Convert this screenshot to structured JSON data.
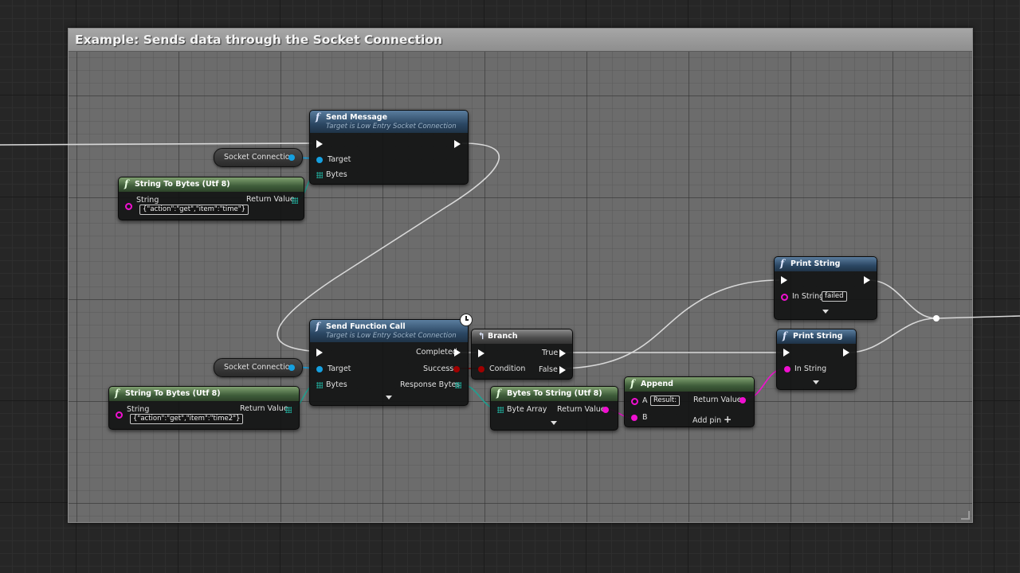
{
  "comment": {
    "title": "Example: Sends data through the Socket Connection"
  },
  "icons": {
    "function": "f-function-icon",
    "branch": "branch-icon",
    "latent": "clock-icon",
    "add": "plus-icon"
  },
  "colors": {
    "exec_wire": "#dddddd",
    "object_pin": "#15a0e0",
    "string_pin": "#f010d0",
    "bool_pin": "#a00000",
    "byte_array_pin": "#20a090"
  },
  "getter1": {
    "label": "Socket Connection"
  },
  "getter2": {
    "label": "Socket Connection"
  },
  "send_message": {
    "title": "Send Message",
    "subtitle": "Target is Low Entry Socket Connection",
    "target": "Target",
    "bytes": "Bytes"
  },
  "string_to_bytes1": {
    "title": "String To Bytes (Utf 8)",
    "string_label": "String",
    "string_value": "{\"action\":\"get\",\"item\":\"time\"}",
    "return_value": "Return Value"
  },
  "send_function_call": {
    "title": "Send Function Call",
    "subtitle": "Target is Low Entry Socket Connection",
    "completed": "Completed",
    "target": "Target",
    "success": "Success",
    "bytes": "Bytes",
    "response_bytes": "Response Bytes"
  },
  "string_to_bytes2": {
    "title": "String To Bytes (Utf 8)",
    "string_label": "String",
    "string_value": "{\"action\":\"get\",\"item\":\"time2\"}",
    "return_value": "Return Value"
  },
  "branch": {
    "title": "Branch",
    "true": "True",
    "condition": "Condition",
    "false": "False"
  },
  "bytes_to_string": {
    "title": "Bytes To String (Utf 8)",
    "byte_array": "Byte Array",
    "return_value": "Return Value"
  },
  "append": {
    "title": "Append",
    "a": "A",
    "a_value": "Result:",
    "b": "B",
    "return_value": "Return Value",
    "add_pin": "Add pin"
  },
  "print_string1": {
    "title": "Print String",
    "in_string": "In String",
    "in_string_value": "failed"
  },
  "print_string2": {
    "title": "Print String",
    "in_string": "In String"
  }
}
